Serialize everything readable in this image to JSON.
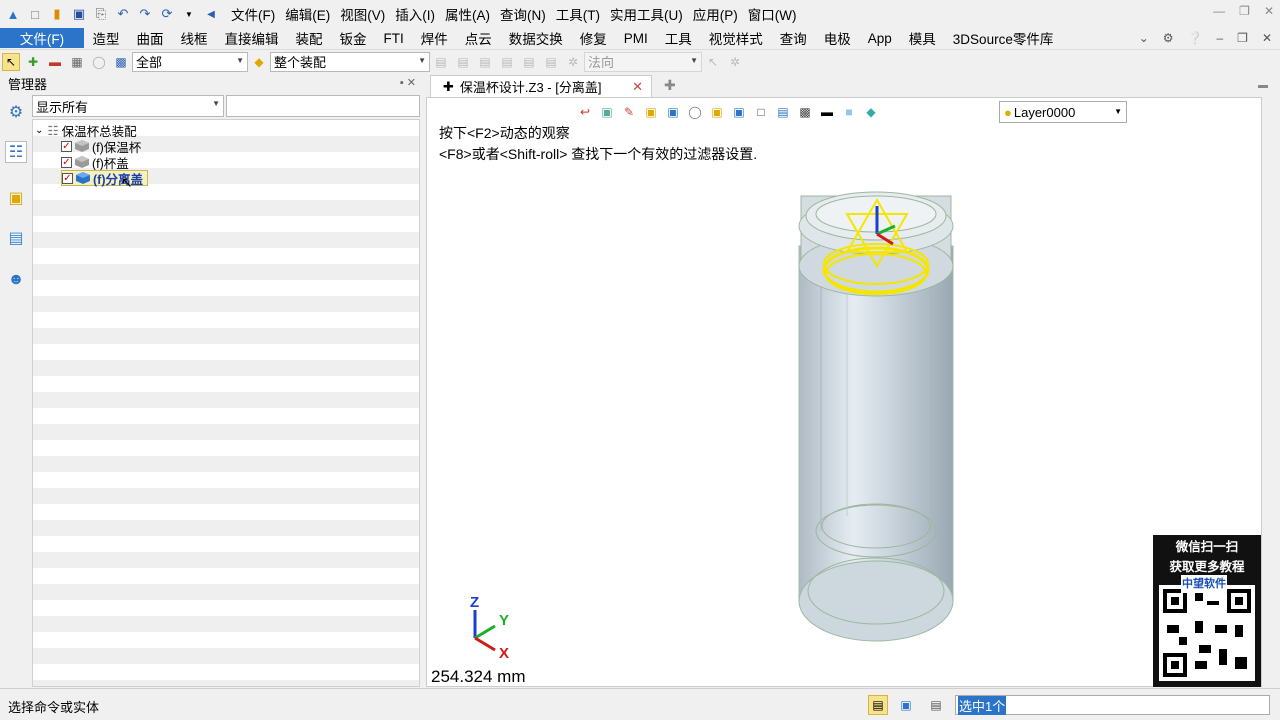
{
  "window": {
    "menus": [
      "文件(F)",
      "编辑(E)",
      "视图(V)",
      "插入(I)",
      "属性(A)",
      "查询(N)",
      "工具(T)",
      "实用工具(U)",
      "应用(P)",
      "窗口(W)"
    ]
  },
  "ribbon": {
    "file_label": "文件(F)",
    "tabs": [
      "造型",
      "曲面",
      "线框",
      "直接编辑",
      "装配",
      "钣金",
      "FTI",
      "焊件",
      "点云",
      "数据交换",
      "修复",
      "PMI",
      "工具",
      "视觉样式",
      "查询",
      "电极",
      "App",
      "模具",
      "3DSource零件库"
    ]
  },
  "toolbar": {
    "filter_value": "全部",
    "scope_value": "整个装配",
    "direction_placeholder": "法向"
  },
  "manager": {
    "title": "管理器",
    "filter_value": "显示所有",
    "tree": {
      "root": "保温杯总装配",
      "children": [
        {
          "label": "(f)保温杯",
          "checked": true,
          "selected": false
        },
        {
          "label": "(f)杯盖",
          "checked": true,
          "selected": false
        },
        {
          "label": "(f)分离盖",
          "checked": true,
          "selected": true
        }
      ]
    }
  },
  "viewport": {
    "tab_title": "保温杯设计.Z3 - [分离盖]",
    "layer": "Layer0000",
    "hint_line1": "按下<F2>动态的观察",
    "hint_line2": "<F8>或者<Shift-roll> 查找下一个有效的过滤器设置.",
    "distance": "254.324 mm",
    "axes": {
      "x": "X",
      "y": "Y",
      "z": "Z"
    },
    "qr": {
      "line1": "微信扫一扫",
      "line2": "获取更多教程",
      "brand": "中望软件"
    }
  },
  "status": {
    "message": "选择命令或实体",
    "selection": "选中1个"
  },
  "colors": {
    "accent": "#2b74c9",
    "highlight": "#f5e600",
    "cup_body": "#c7d3dc"
  }
}
